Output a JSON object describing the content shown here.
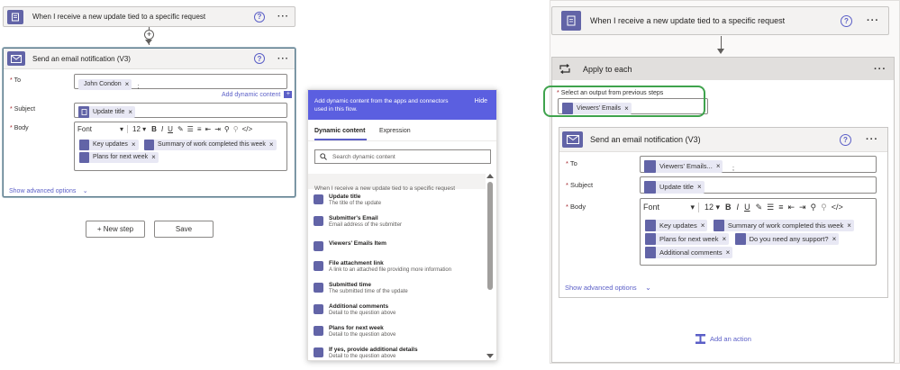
{
  "left": {
    "trigger": {
      "title": "When I receive a new update tied to a specific request",
      "help": "?",
      "more": "···"
    },
    "email_card": {
      "title": "Send an email notification (V3)",
      "help": "?",
      "more": "···",
      "to_label": "To",
      "to_token": "John Condon",
      "to_suffix": ";",
      "add_dynamic": "Add dynamic content",
      "subject_label": "Subject",
      "subject_token": "Update title",
      "body_label": "Body",
      "toolbar": {
        "font": "Font",
        "size": "12"
      },
      "body_tokens": [
        "Key updates",
        "Summary of work completed this week",
        "Plans for next week"
      ],
      "show_advanced": "Show advanced options"
    },
    "new_step": "+ New step",
    "save": "Save"
  },
  "dynamic_panel": {
    "header_text": "Add dynamic content from the apps and connectors used in this flow.",
    "hide": "Hide",
    "tabs": [
      "Dynamic content",
      "Expression"
    ],
    "search_placeholder": "Search dynamic content",
    "section": "When I receive a new update tied to a specific request",
    "items": [
      {
        "title": "Update title",
        "sub": "The title of the update"
      },
      {
        "title": "Submitter's Email",
        "sub": "Email address of the submitter"
      },
      {
        "title": "Viewers' Emails Item",
        "sub": ""
      },
      {
        "title": "File attachment link",
        "sub": "A link to an attached file providing more information"
      },
      {
        "title": "Submitted time",
        "sub": "The submitted time of the update"
      },
      {
        "title": "Additional comments",
        "sub": "Detail to the question above"
      },
      {
        "title": "Plans for next week",
        "sub": "Detail to the question above"
      },
      {
        "title": "If yes, provide additional details",
        "sub": "Detail to the question above"
      }
    ]
  },
  "right": {
    "trigger": {
      "title": "When I receive a new update tied to a specific request",
      "help": "?",
      "more": "···"
    },
    "apply": {
      "title": "Apply to each",
      "more": "···",
      "select_label": "Select an output from previous steps",
      "select_token": "Viewers' Emails"
    },
    "email_card": {
      "title": "Send an email notification (V3)",
      "help": "?",
      "more": "···",
      "to_label": "To",
      "to_token": "Viewers' Emails...",
      "to_suffix": ";",
      "subject_label": "Subject",
      "subject_token": "Update title",
      "body_label": "Body",
      "toolbar": {
        "font": "Font",
        "size": "12"
      },
      "body_tokens": [
        "Key updates",
        "Summary of work completed this week",
        "Plans for next week",
        "Do you need any support?",
        "Additional comments"
      ],
      "show_advanced": "Show advanced options"
    },
    "add_action": "Add an action"
  },
  "colors": {
    "accent": "#6264a7",
    "link": "#5b5fc7",
    "highlight": "#3fa34d",
    "panel_header": "#5b5fe0"
  }
}
